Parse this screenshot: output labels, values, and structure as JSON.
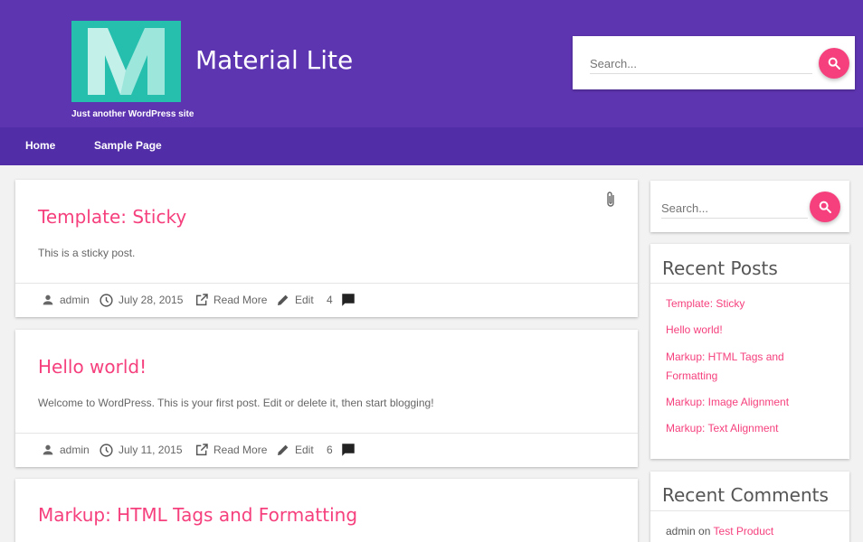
{
  "site": {
    "title": "Material Lite",
    "tagline": "Just another WordPress site"
  },
  "header_search": {
    "placeholder": "Search..."
  },
  "nav": {
    "items": [
      "Home",
      "Sample Page"
    ]
  },
  "posts": [
    {
      "title": "Template: Sticky",
      "excerpt": "This is a sticky post.",
      "author": "admin",
      "date": "July 28, 2015",
      "read_more": "Read More",
      "edit": "Edit",
      "comments": "4"
    },
    {
      "title": "Hello world!",
      "excerpt": "Welcome to WordPress. This is your first post. Edit or delete it, then start blogging!",
      "author": "admin",
      "date": "July 11, 2015",
      "read_more": "Read More",
      "edit": "Edit",
      "comments": "6"
    },
    {
      "title": "Markup: HTML Tags and Formatting"
    }
  ],
  "sidebar": {
    "search": {
      "placeholder": "Search..."
    },
    "recent_posts": {
      "title": "Recent Posts",
      "items": [
        "Template: Sticky",
        "Hello world!",
        "Markup: HTML Tags and Formatting",
        "Markup: Image Alignment",
        "Markup: Text Alignment"
      ]
    },
    "recent_comments": {
      "title": "Recent Comments",
      "items": [
        {
          "author": "admin",
          "on": "on",
          "post": "Test Product"
        }
      ]
    }
  },
  "colors": {
    "header": "#5e35b1",
    "nav": "#512da8",
    "accent": "#f5407d",
    "logo": "#26bfae"
  }
}
